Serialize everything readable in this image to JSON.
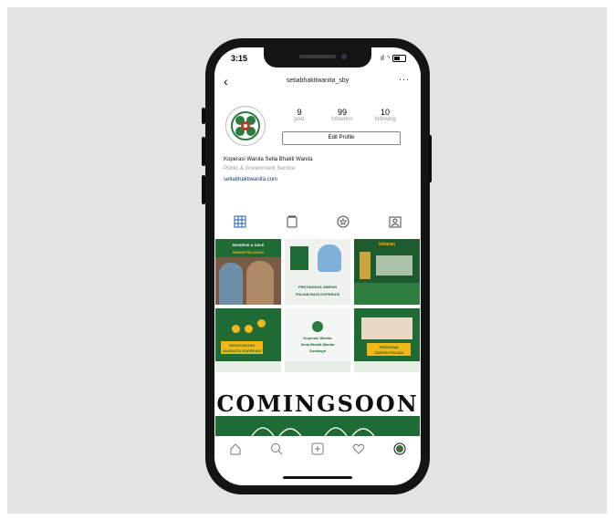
{
  "status_bar": {
    "time": "3:15",
    "signal": "ıl",
    "wifi": "◝"
  },
  "header": {
    "back": "‹",
    "username": "setiabhaktiwanita_sby",
    "more": "···"
  },
  "profile": {
    "stats": [
      {
        "num": "9",
        "label": "post"
      },
      {
        "num": "99",
        "label": "followers"
      },
      {
        "num": "10",
        "label": "following"
      }
    ],
    "edit_label": "Edit Profile",
    "name": "Koperasi Wanita Setia Bhakti Wanita",
    "category": "Public & Government Service",
    "link": "setiabhaktiwanita.com"
  },
  "posts": {
    "p1_title": "RESERVE & SAVE",
    "p1_sub": "BISNIS PELUANG",
    "p2_title": "PENTINGNYA SIMPAN",
    "p2_sub": "PINJAM BAGI KOPERASI",
    "p3_title": "lebaran",
    "p4_title": "KEUNTUNGAN",
    "p4_sub": "ANGGOTA KOPERASI",
    "p5_title": "Koperasi Wanita",
    "p5_sub": "Setia Bhakti Wanita",
    "p5_sub2": "Surabaya",
    "p6_title": "PROGRAM",
    "p6_sub": "SIMPAN PINJAM",
    "coming_soon": "COMINGSOON"
  },
  "colors": {
    "brand_green": "#1e6b36",
    "accent_gold": "#f2b71b"
  },
  "icons": [
    "back-icon",
    "more-icon",
    "grid-icon",
    "igtv-icon",
    "tagged-icon",
    "guide-icon",
    "home-icon",
    "search-icon",
    "add-icon",
    "heart-icon",
    "profile-icon"
  ]
}
